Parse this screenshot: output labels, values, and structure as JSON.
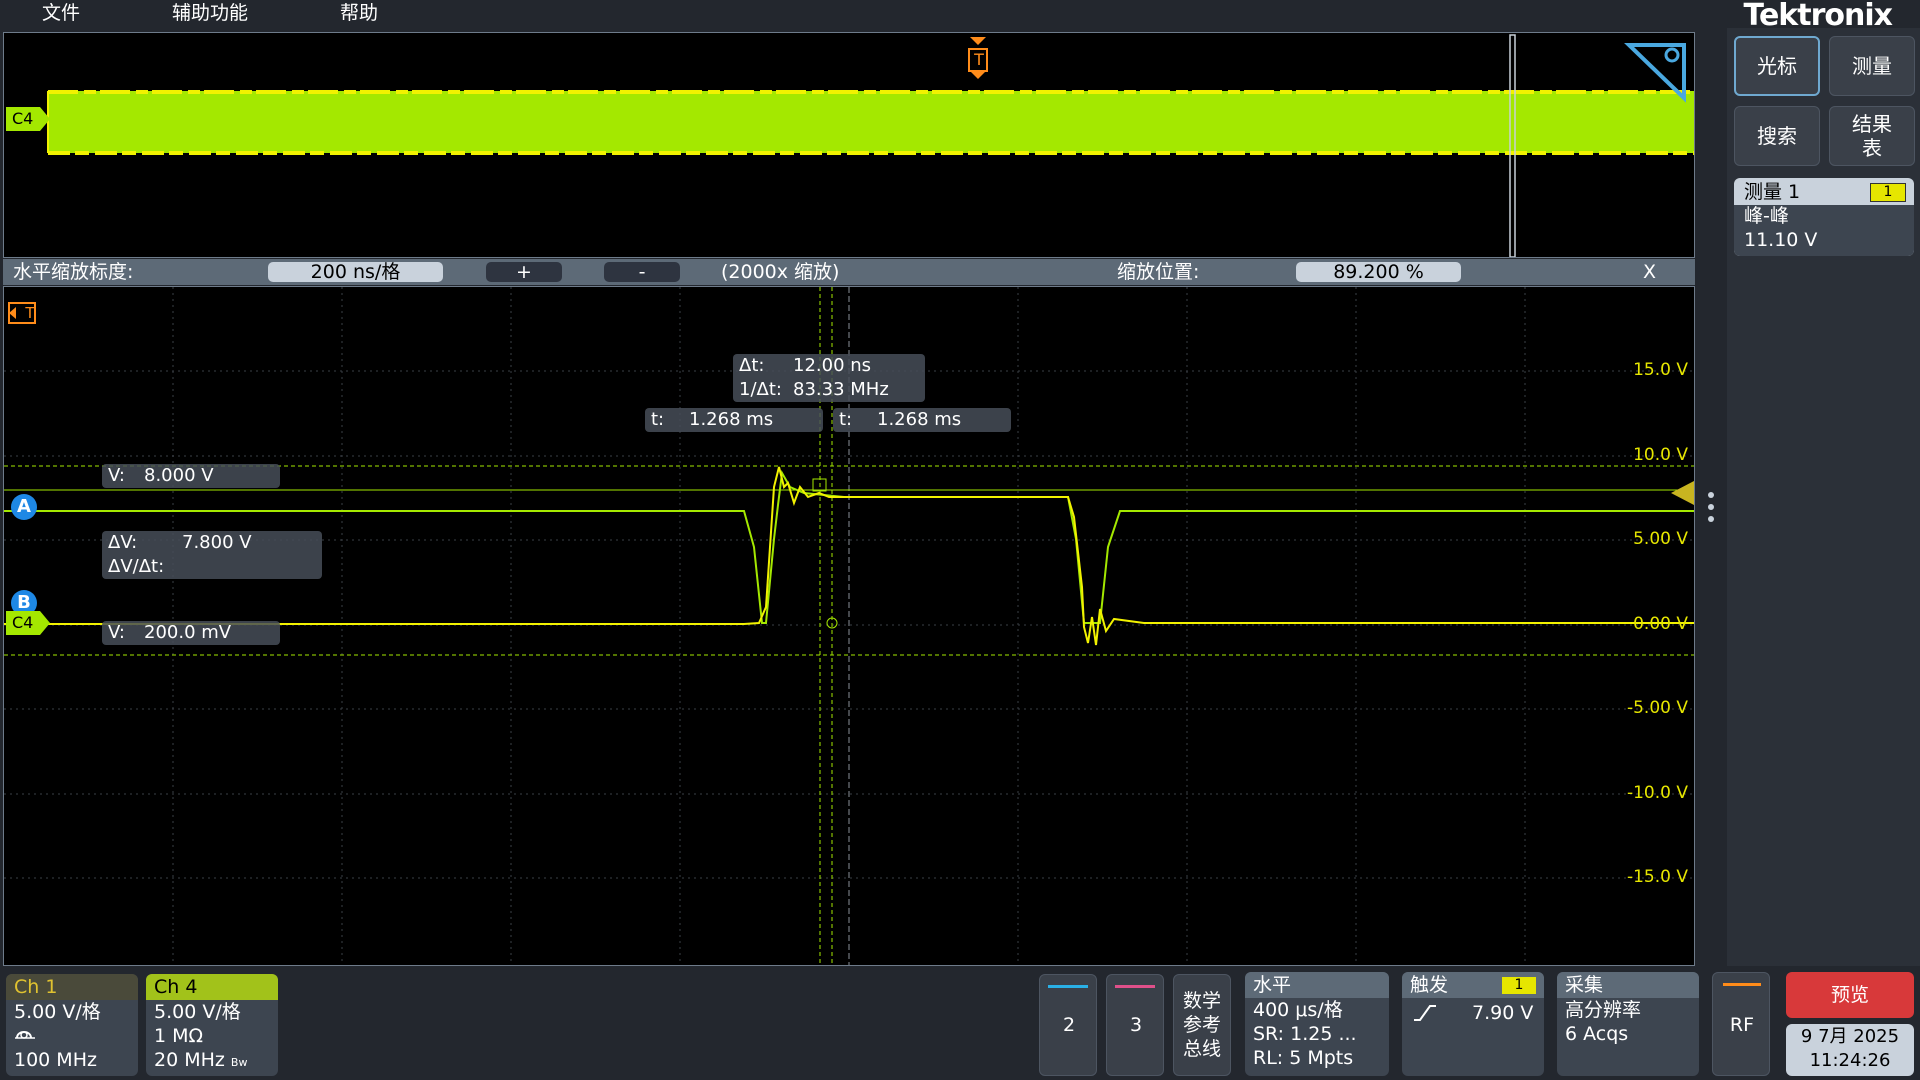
{
  "menu": {
    "file": "文件",
    "utility": "辅助功能",
    "help": "帮助"
  },
  "brand": "Tektronix",
  "colors": {
    "ch4": "#f2f200",
    "ch1": "#e0c230",
    "ch4_badge": "#a2c21a",
    "cursor_green": "#a4e800",
    "accent_blue": "#6fa9d0"
  },
  "overview": {
    "channel": "C4",
    "trigger": "T"
  },
  "zoom": {
    "scale_label": "水平缩放标度:",
    "scale_value": "200 ns/格",
    "plus": "+",
    "minus": "-",
    "factor": "(2000x 缩放)",
    "position_label": "缩放位置:",
    "position_value": "89.200 %",
    "close": "X"
  },
  "main": {
    "trigger": "T",
    "cursor_a": "A",
    "cursor_b": "B",
    "channel": "C4",
    "delta_t_label": "Δt:",
    "delta_t_value": "12.00 ns",
    "inv_delta_t_label": "1/Δt:",
    "inv_delta_t_value": "83.33 MHz",
    "t1_label": "t:",
    "t1_value": "1.268 ms",
    "t2_label": "t:",
    "t2_value": "1.268 ms",
    "va_label": "V:",
    "va_value": "8.000 V",
    "dv_label": "ΔV:",
    "dv_value": "7.800 V",
    "dvdt_label": "ΔV/Δt:",
    "vb_label": "V:",
    "vb_value": "200.0 mV",
    "y_ticks": [
      "15.0 V",
      "10.0 V",
      "5.00 V",
      "0.00 V",
      "-5.00 V",
      "-10.0 V",
      "-15.0 V"
    ]
  },
  "side": {
    "cursor": "光标",
    "measure": "测量",
    "search": "搜索",
    "results": "结果表",
    "meas1_title": "测量 1",
    "meas1_badge": "1",
    "meas1_type": "峰-峰",
    "meas1_value": "11.10 V"
  },
  "bottom": {
    "ch1": {
      "title": "Ch 1",
      "scale": "5.00 V/格",
      "icon": "probe-icon",
      "bw": "100 MHz"
    },
    "ch4": {
      "title": "Ch 4",
      "scale": "5.00 V/格",
      "imp": "1 MΩ",
      "bw": "20 MHz",
      "bw_mark": "Bw"
    },
    "btn2": "2",
    "btn3": "3",
    "math_l1": "数学",
    "math_l2": "参考",
    "math_l3": "总线",
    "horizontal": {
      "title": "水平",
      "scale": "400 μs/格",
      "sr": "SR: 1.25 ...",
      "rl": "RL: 5 Mpts"
    },
    "trigger": {
      "title": "触发",
      "badge": "1",
      "level": "7.90 V"
    },
    "acq": {
      "title": "采集",
      "mode": "高分辨率",
      "count": "6 Acqs"
    },
    "rf": "RF",
    "preview": "预览",
    "date": "9 7月 2025",
    "time": "11:24:26"
  }
}
